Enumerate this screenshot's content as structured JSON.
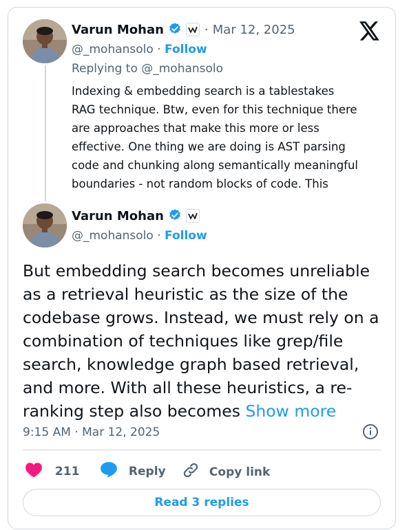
{
  "parent_tweet": {
    "author_name": "Varun Mohan",
    "handle": "@_mohansolo",
    "separator": "·",
    "follow_label": "Follow",
    "date": "Mar 12, 2025",
    "replying_prefix": "Replying to",
    "replying_to": "@_mohansolo",
    "text_lines": [
      "Indexing & embedding search is a tablestakes",
      "RAG technique. Btw, even for this technique there",
      "are approaches that make this more or less",
      "effective. One thing we are doing is AST parsing",
      "code and chunking along semantically meaningful",
      "boundaries - not random blocks of code. This"
    ]
  },
  "main_tweet": {
    "author_name": "Varun Mohan",
    "handle": "@_mohansolo",
    "separator": "·",
    "follow_label": "Follow",
    "text_lines": [
      "But embedding search becomes unreliable",
      "as a retrieval heuristic as the size of the",
      "codebase grows. Instead, we must rely on a",
      "combination of techniques like grep/file",
      "search, knowledge graph based retrieval,",
      "and more. With all these heuristics, a re-",
      "ranking step also becomes"
    ],
    "show_more": "Show more",
    "time": "9:15 AM",
    "date": "Mar 12, 2025"
  },
  "actions": {
    "like_count": "211",
    "reply_label": "Reply",
    "copy_link_label": "Copy link"
  },
  "read_replies_label": "Read 3 replies",
  "colors": {
    "brand_blue": "#1d9bf0",
    "like_pink": "#f91880",
    "verified_blue": "#1d9bf0",
    "muted_text": "#536471",
    "border": "#cfd9de"
  },
  "icons": [
    "x-logo-icon",
    "verified-badge-icon",
    "windsurf-badge-icon",
    "info-icon",
    "heart-icon",
    "reply-bubble-icon",
    "link-icon"
  ]
}
